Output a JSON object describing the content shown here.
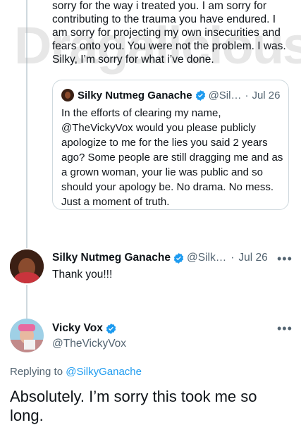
{
  "watermark": "Dragalicious",
  "top_tweet": {
    "text": "sorry for the way i treated you. I am sorry for contributing to the trauma you have endured. I am sorry for projecting my own insecurities and fears onto you. You were not the problem. I was. Silky, I’m sorry for what i’ve done."
  },
  "quoted_tweet": {
    "name": "Silky Nutmeg Ganache",
    "handle": "@Sil…",
    "separator": "·",
    "date": "Jul 26",
    "text": "In the efforts of clearing my name, @TheVickyVox would you please publicly apologize to me for the lies you said 2 years ago?  Some people are still dragging me and as a grown woman, your lie was public and so should your apology be. No drama. No mess. Just a moment of truth."
  },
  "reply_tweet": {
    "name": "Silky Nutmeg Ganache",
    "handle": "@Silk…",
    "separator": "·",
    "date": "Jul 26",
    "text": "Thank you!!!",
    "more": "•••"
  },
  "main_tweet": {
    "name": "Vicky Vox",
    "handle": "@TheVickyVox",
    "more": "•••",
    "replying_prefix": "Replying to",
    "replying_handle": "@SilkyGanache",
    "text": "Absolutely. I’m sorry this took me so long."
  },
  "colors": {
    "verified": "#1d9bf0",
    "link": "#1d9bf0",
    "muted": "#536471",
    "border": "#cfd9de"
  },
  "icons": [
    "verified-badge-icon",
    "more-icon"
  ]
}
